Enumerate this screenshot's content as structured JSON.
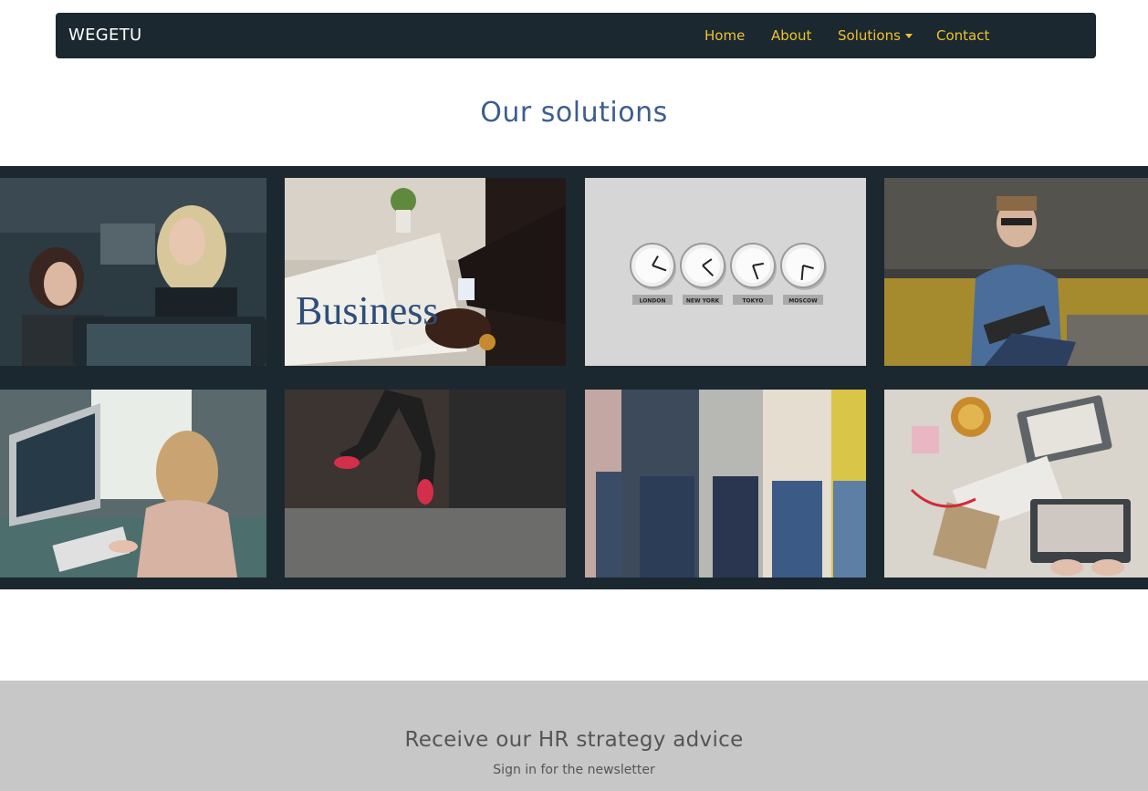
{
  "navbar": {
    "brand": "WEGETU",
    "links": {
      "home": "Home",
      "about": "About",
      "solutions": "Solutions",
      "contact": "Contact"
    }
  },
  "main": {
    "title": "Our solutions",
    "gallery": {
      "clock_labels": [
        "LONDON",
        "NEW YORK",
        "TOKYO",
        "MOSCOW"
      ],
      "newspaper_headline": "Business"
    }
  },
  "newsletter": {
    "title": "Receive our HR strategy advice",
    "subtitle": "Sign in for the newsletter"
  },
  "colors": {
    "nav_bg": "#1b2830",
    "nav_link": "#f0c22e",
    "title_blue": "#3d5d8f",
    "gallery_bg": "#1b2830",
    "newsletter_bg": "#c7c7c7"
  }
}
